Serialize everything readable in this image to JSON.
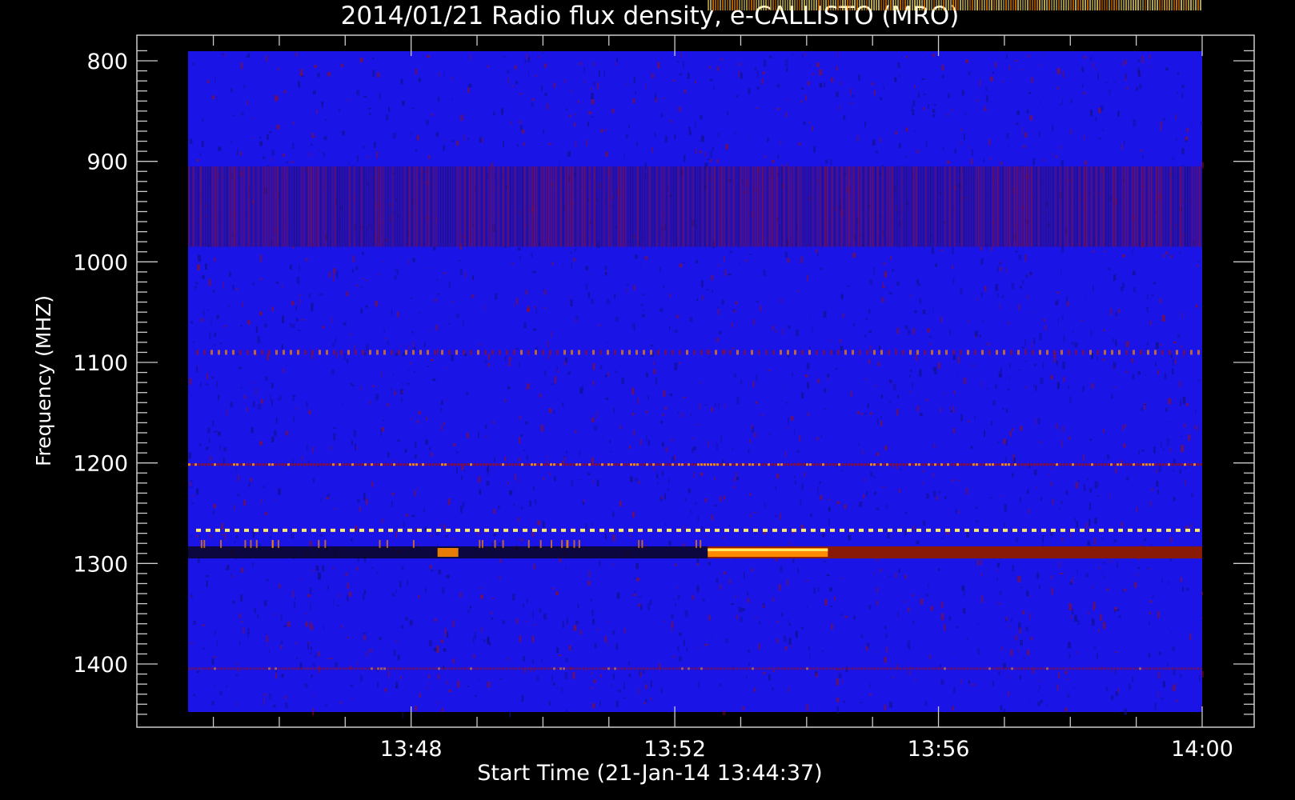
{
  "chart_data": {
    "type": "heatmap",
    "title": "2014/01/21  Radio flux density, e-CALLISTO (MRO)",
    "xlabel": "Start Time (21-Jan-14 13:44:37)",
    "ylabel": "Frequency (MHZ)",
    "x_ticks": [
      "13:48",
      "13:52",
      "13:56",
      "14:00"
    ],
    "y_ticks": [
      800,
      900,
      1000,
      1100,
      1200,
      1300,
      1400
    ],
    "xlim": [
      "13:44:37",
      "14:00:00"
    ],
    "ylim": [
      790,
      1450
    ],
    "y_inverted": true,
    "colors": {
      "background": "#1a14e6",
      "noise_dark": "#12108a",
      "noise_red": "#8a1030",
      "burst_orange": "#ff8a00",
      "burst_yellow": "#ffe96a"
    },
    "features": [
      {
        "kind": "rfi_band",
        "freq_mhz": [
          905,
          985
        ],
        "intensity": "medium"
      },
      {
        "kind": "dotted_line",
        "freq_mhz": 1090,
        "intensity": "low"
      },
      {
        "kind": "line",
        "freq_mhz": 1202,
        "intensity": "medium"
      },
      {
        "kind": "dotted_line",
        "freq_mhz": 1267,
        "intensity": "high"
      },
      {
        "kind": "dark_band",
        "freq_mhz": [
          1283,
          1295
        ],
        "time": [
          "13:44:37",
          "13:52:30"
        ]
      },
      {
        "kind": "burst",
        "freq_mhz": [
          1283,
          1295
        ],
        "time": [
          "13:52:30",
          "14:00:00"
        ],
        "intensity": "high"
      },
      {
        "kind": "line",
        "freq_mhz": 1405,
        "intensity": "low"
      }
    ]
  }
}
